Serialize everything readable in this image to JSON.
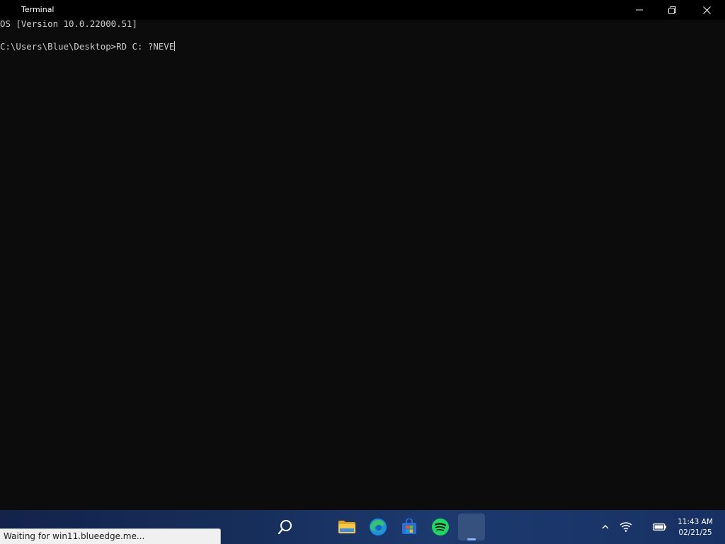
{
  "window": {
    "title": "Terminal",
    "controls": {
      "minimize_icon": "minimize-icon",
      "maximize_icon": "restore-icon",
      "close_icon": "close-icon"
    }
  },
  "terminal": {
    "lines": [
      "OS [Version 10.0.22000.51]",
      "",
      "C:\\Users\\Blue\\Desktop>RD C: ?NEVE"
    ],
    "background_color": "#0c0c0c",
    "text_color": "#cccccc"
  },
  "taskbar": {
    "apps": [
      {
        "name": "Search",
        "icon": "search-icon"
      },
      {
        "name": "File Explorer",
        "icon": "folder-icon"
      },
      {
        "name": "Microsoft Edge",
        "icon": "edge-icon"
      },
      {
        "name": "Microsoft Store",
        "icon": "store-icon"
      },
      {
        "name": "Spotify",
        "icon": "spotify-icon"
      },
      {
        "name": "Terminal",
        "icon": "terminal-icon",
        "active": true
      }
    ],
    "tray": {
      "chevron_icon": "chevron-up-icon",
      "wifi_icon": "wifi-icon",
      "battery_icon": "battery-icon"
    },
    "clock": {
      "time": "11:43 AM",
      "date": "02/21/25"
    }
  },
  "status_bubble": {
    "text": "Waiting for win11.blueedge.me..."
  }
}
